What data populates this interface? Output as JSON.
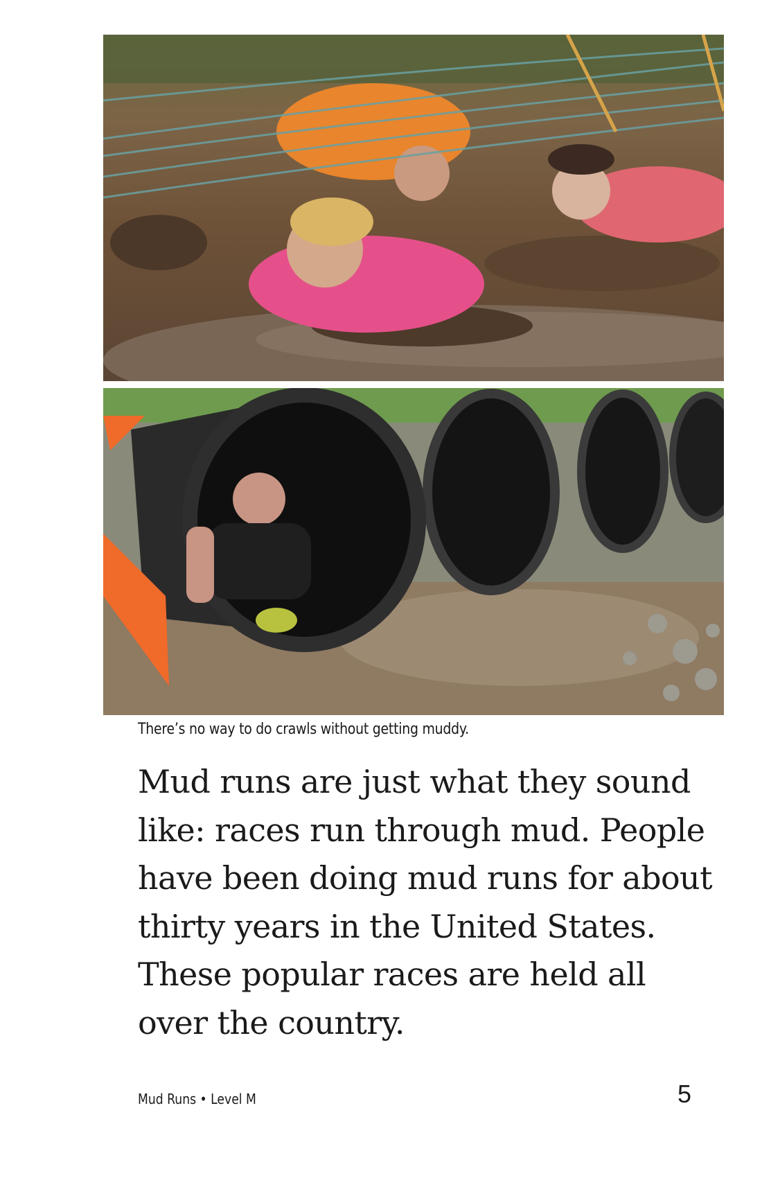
{
  "caption": "There’s no way to do crawls without getting muddy.",
  "body_text": "Mud runs are just what they sound like: races run through mud. People have been doing mud runs for about thirty years in the United States. These popular races are held all over the country.",
  "footer": {
    "book_title": "Mud Runs • Level M",
    "page_number": "5"
  }
}
